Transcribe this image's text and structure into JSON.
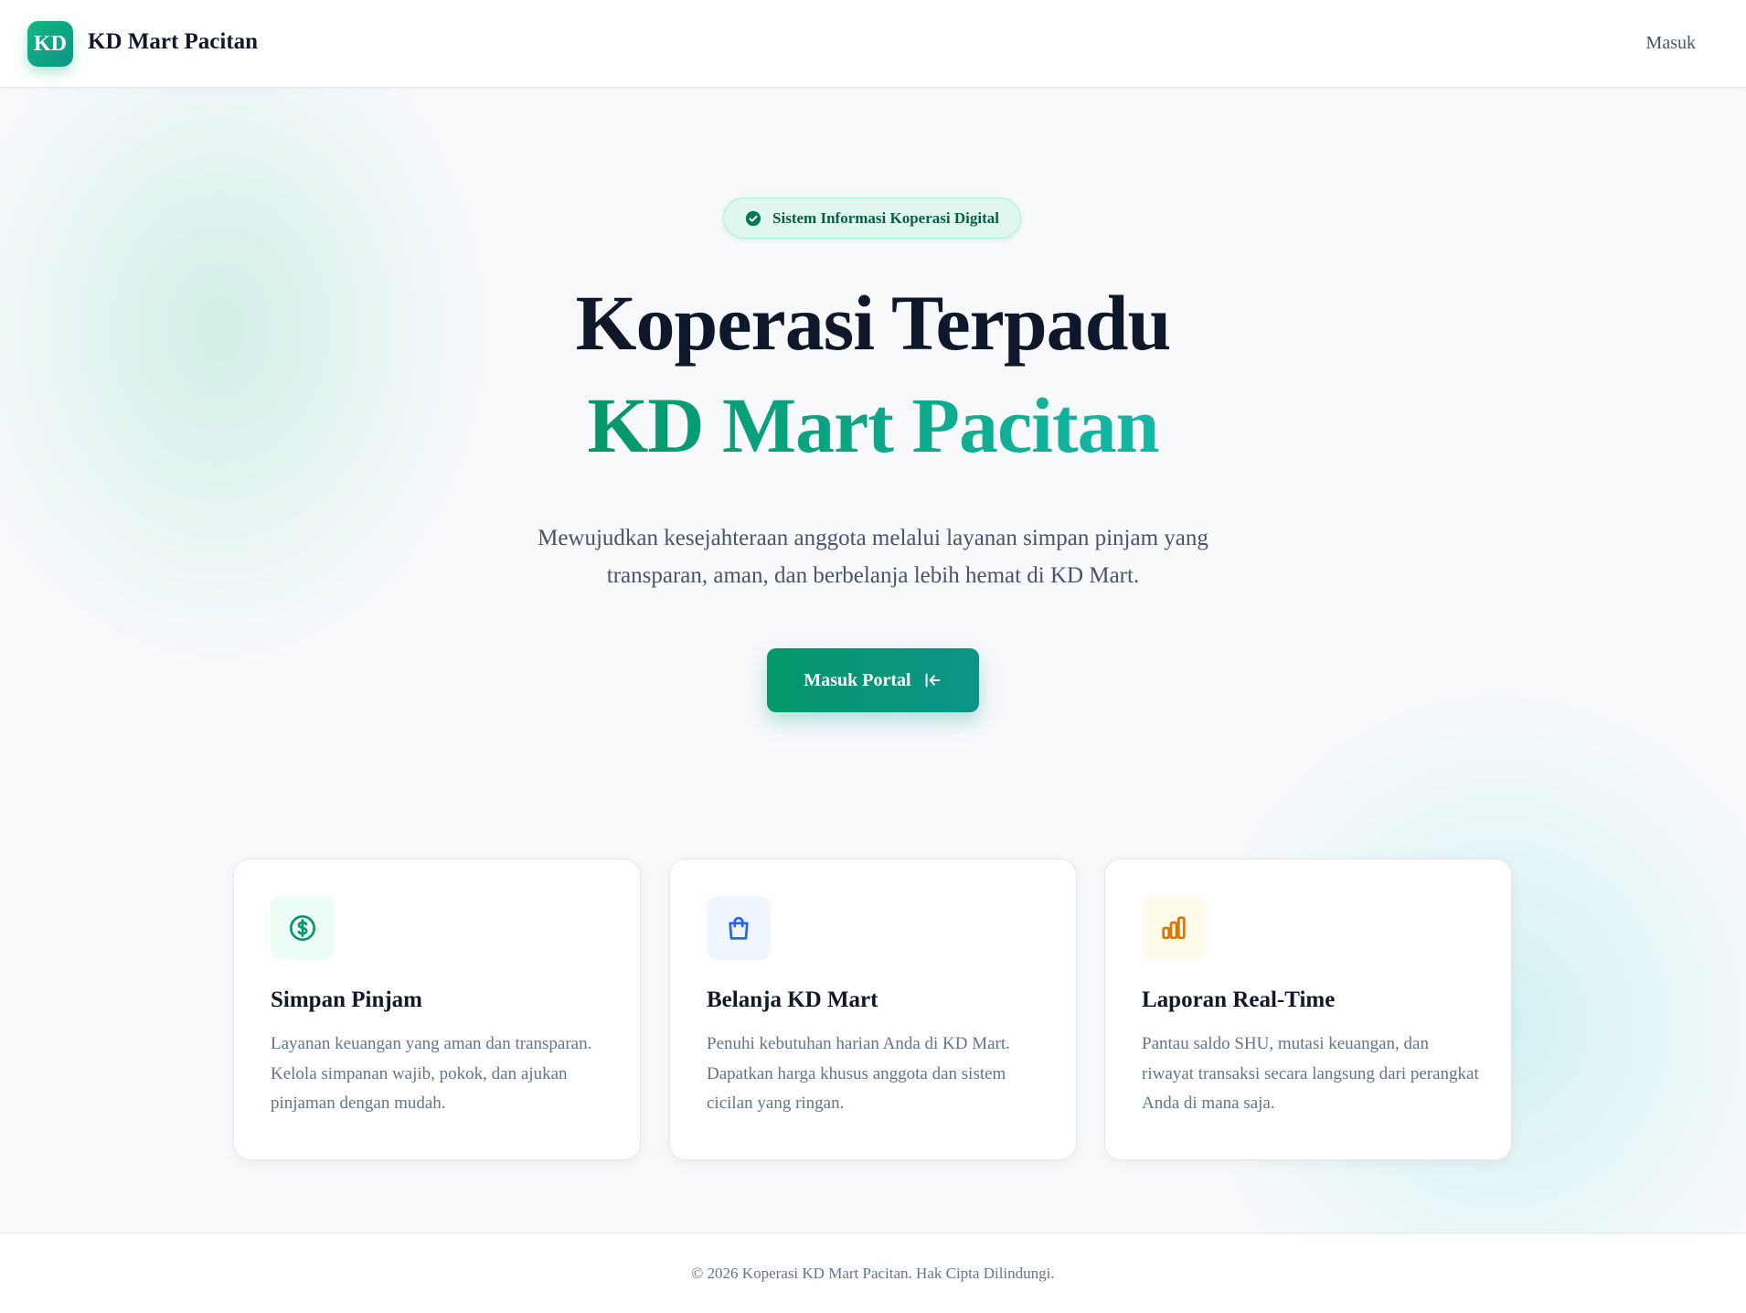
{
  "header": {
    "logo_text": "KD",
    "brand_name": "KD Mart Pacitan",
    "login_label": "Masuk"
  },
  "hero": {
    "badge": {
      "icon": "check-circle-icon",
      "label": "Sistem Informasi Koperasi Digital"
    },
    "title_line1": "Koperasi Terpadu",
    "title_line2": "KD Mart Pacitan",
    "subtitle": "Mewujudkan kesejahteraan anggota melalui layanan simpan pinjam yang transparan, aman, dan berbelanja lebih hemat di KD Mart.",
    "cta": {
      "label": "Masuk Portal",
      "icon": "login-arrow-icon"
    }
  },
  "features": [
    {
      "icon": "dollar-circle-icon",
      "icon_color": "#059669",
      "icon_bg": "#ecfdf5",
      "title": "Simpan Pinjam",
      "description": "Layanan keuangan yang aman dan transparan. Kelola simpanan wajib, pokok, dan ajukan pinjaman dengan mudah."
    },
    {
      "icon": "shopping-bag-icon",
      "icon_color": "#2563eb",
      "icon_bg": "#eff6ff",
      "title": "Belanja KD Mart",
      "description": "Penuhi kebutuhan harian Anda di KD Mart. Dapatkan harga khusus anggota dan sistem cicilan yang ringan."
    },
    {
      "icon": "bar-chart-icon",
      "icon_color": "#d97706",
      "icon_bg": "#fffbeb",
      "title": "Laporan Real-Time",
      "description": "Pantau saldo SHU, mutasi keuangan, dan riwayat transaksi secara langsung dari perangkat Anda di mana saja."
    }
  ],
  "footer": {
    "copyright": "© 2026 Koperasi KD Mart Pacitan. Hak Cipta Dilindungi."
  },
  "colors": {
    "primary": "#059669",
    "primary_dark": "#0d9488",
    "text_dark": "#0f172a",
    "text_muted": "#64748b"
  }
}
